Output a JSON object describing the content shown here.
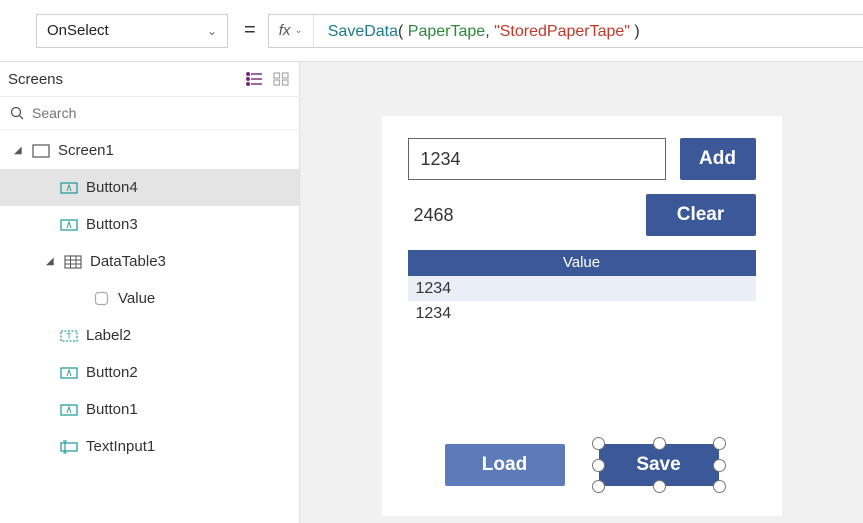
{
  "topbar": {
    "property": "OnSelect",
    "equals": "=",
    "fx": "fx",
    "formula": {
      "func": "SaveData",
      "open": "( ",
      "arg1": "PaperTape",
      "comma": ", ",
      "arg2": "\"StoredPaperTape\"",
      "close": " )"
    }
  },
  "tree": {
    "title": "Screens",
    "search_placeholder": "Search",
    "items": [
      {
        "label": "Screen1"
      },
      {
        "label": "Button4"
      },
      {
        "label": "Button3"
      },
      {
        "label": "DataTable3"
      },
      {
        "label": "Value"
      },
      {
        "label": "Label2"
      },
      {
        "label": "Button2"
      },
      {
        "label": "Button1"
      },
      {
        "label": "TextInput1"
      }
    ]
  },
  "app": {
    "textinput_value": "1234",
    "add_label": "Add",
    "result_label": "2468",
    "clear_label": "Clear",
    "datatable_header": "Value",
    "rows": [
      "1234",
      "1234"
    ],
    "load_label": "Load",
    "save_label": "Save"
  }
}
